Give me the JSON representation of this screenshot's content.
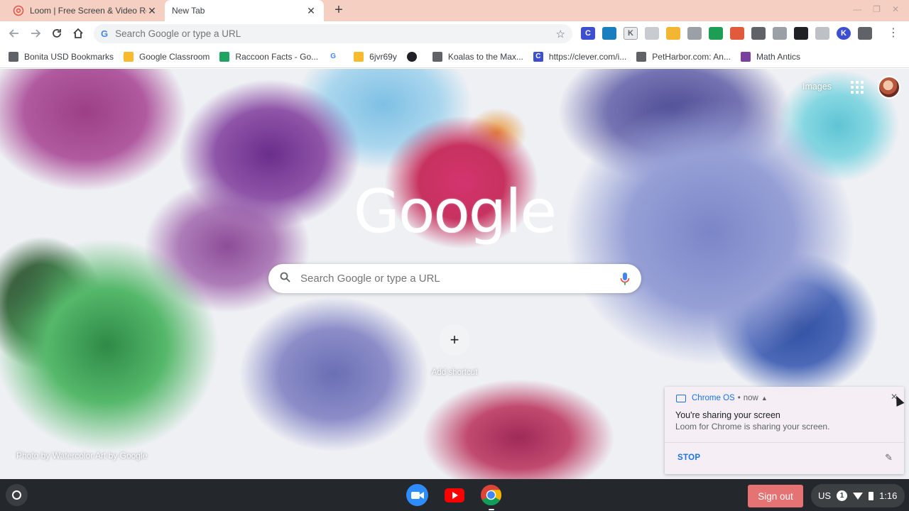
{
  "tabs": [
    {
      "title": "Loom | Free Screen & Video Recording",
      "active": false,
      "favicon": "loom-icon"
    },
    {
      "title": "New Tab",
      "active": true,
      "favicon": ""
    }
  ],
  "omnibox": {
    "placeholder": "Search Google or type a URL"
  },
  "extensions": [
    {
      "icon": "clever-c-icon",
      "label": "C",
      "color": "#3d4fd1"
    },
    {
      "icon": "image-ext-icon",
      "label": "",
      "color": "#1b7fbf"
    },
    {
      "icon": "k-ext-icon",
      "label": "K",
      "color": "#e8eaed"
    },
    {
      "icon": "puzzle-ext-icon",
      "label": "",
      "color": "#c8ccd0"
    },
    {
      "icon": "thumbs-up-icon",
      "label": "",
      "color": "#f2b632"
    },
    {
      "icon": "apple-icon",
      "label": "",
      "color": "#9aa0a6"
    },
    {
      "icon": "green-check-ext-icon",
      "label": "",
      "color": "#1e9e54"
    },
    {
      "icon": "megaphone-icon",
      "label": "",
      "color": "#e15a3c"
    },
    {
      "icon": "pen-icon",
      "label": "",
      "color": "#5f6368"
    },
    {
      "icon": "screen-ext-icon",
      "label": "",
      "color": "#9aa0a6"
    },
    {
      "icon": "glasses-icon",
      "label": "",
      "color": "#202124"
    },
    {
      "icon": "reader-ext-icon",
      "label": "",
      "color": "#bdc1c6"
    },
    {
      "icon": "k-circle-icon",
      "label": "K",
      "color": "#3d4fd1"
    },
    {
      "icon": "loom-ext-icon",
      "label": "",
      "color": "#5f6368"
    }
  ],
  "bookmarks": [
    {
      "label": "Bonita USD Bookmarks",
      "icon": "folder-icon",
      "color": "#5f6368"
    },
    {
      "label": "Google Classroom",
      "icon": "classroom-icon",
      "color": "#f9bb2d"
    },
    {
      "label": "Raccoon Facts - Go...",
      "icon": "drive-icon",
      "color": "#1fa463"
    },
    {
      "label": "",
      "icon": "google-g-icon",
      "color": "#4285f4"
    },
    {
      "label": "6jvr69y",
      "icon": "classroom-icon",
      "color": "#f9bb2d"
    },
    {
      "label": "",
      "icon": "globe-icon",
      "color": "#202124"
    },
    {
      "label": "Koalas to the Max...",
      "icon": "koala-icon",
      "color": "#5f6368"
    },
    {
      "label": "https://clever.com/i...",
      "icon": "clever-c-icon",
      "color": "#3d4fd1"
    },
    {
      "label": "PetHarbor.com: An...",
      "icon": "petharbor-icon",
      "color": "#5f6368"
    },
    {
      "label": "Math Antics",
      "icon": "math-antics-icon",
      "color": "#7b3fa0"
    }
  ],
  "ntp": {
    "logo": "Google",
    "search_placeholder": "Search Google or type a URL",
    "add_shortcut": "Add shortcut",
    "images_link": "Images",
    "photo_credit": "Photo by Watercolor Art by Google"
  },
  "notification": {
    "source": "Chrome OS",
    "separator": "•",
    "time": "now",
    "title": "You're sharing your screen",
    "body": "Loom for Chrome is sharing your screen.",
    "action": "STOP"
  },
  "shelf": {
    "apps": [
      {
        "icon": "zoom-icon",
        "color": "#2d8cff"
      },
      {
        "icon": "youtube-icon",
        "color": "#ff0000"
      },
      {
        "icon": "chrome-icon",
        "color": "#34a853"
      }
    ],
    "signout": "Sign out",
    "ime": "US",
    "notif_count": "1",
    "time": "1:16"
  }
}
